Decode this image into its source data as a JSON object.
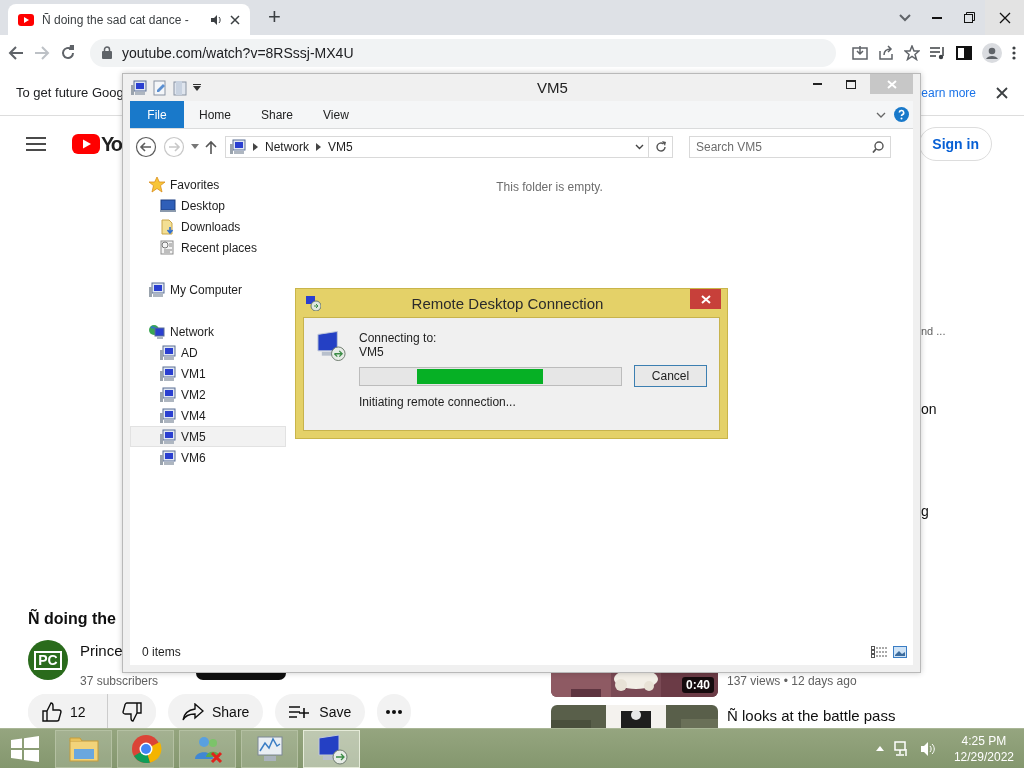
{
  "browser": {
    "tab": {
      "title": "Ñ doing the sad cat dance -"
    },
    "new_tab": "+",
    "url": "youtube.com/watch?v=8RSssj-MX4U",
    "infobar": {
      "text": "To get future Goog",
      "link": "earn more"
    }
  },
  "youtube": {
    "logo_text": "Yo",
    "sign_in": "Sign in",
    "side_texts": [
      "nd ...",
      "on",
      "g"
    ],
    "video_title": "Ñ doing the",
    "channel": {
      "avatar": "PC",
      "name": "Prince",
      "subscribers": "37 subscribers"
    },
    "likes": "12",
    "share": "Share",
    "save": "Save",
    "recommendations": [
      {
        "kind": "picture",
        "duration": "0:40",
        "meta": "137 views • 12 days ago"
      },
      {
        "kind": "picture",
        "title": "Ñ looks at the battle pass"
      }
    ]
  },
  "explorer": {
    "title": "VM5",
    "file_tab": "File",
    "tabs": [
      "Home",
      "Share",
      "View"
    ],
    "breadcrumb": [
      "Network",
      "VM5"
    ],
    "search_placeholder": "Search VM5",
    "nav": [
      {
        "label": "Favorites",
        "kind": "star",
        "selected": false,
        "children": [
          {
            "label": "Desktop",
            "kind": "desktop",
            "selected": false
          },
          {
            "label": "Downloads",
            "kind": "downloads",
            "selected": false
          },
          {
            "label": "Recent places",
            "kind": "recent",
            "selected": false
          }
        ]
      },
      {
        "label": "My Computer",
        "kind": "computer",
        "selected": false
      },
      {
        "label": "Network",
        "kind": "network",
        "selected": false,
        "children": [
          {
            "label": "AD",
            "kind": "computer",
            "selected": false
          },
          {
            "label": "VM1",
            "kind": "computer",
            "selected": false
          },
          {
            "label": "VM2",
            "kind": "computer",
            "selected": false
          },
          {
            "label": "VM4",
            "kind": "computer",
            "selected": false
          },
          {
            "label": "VM5",
            "kind": "computer",
            "selected": true
          },
          {
            "label": "VM6",
            "kind": "computer",
            "selected": false
          }
        ]
      }
    ],
    "empty_text": "This folder is empty.",
    "status": "0 items"
  },
  "dialog": {
    "title": "Remote Desktop Connection",
    "label": "Connecting to:",
    "target": "VM5",
    "level": 0.48,
    "status": "Initiating remote connection...",
    "button": "Cancel"
  },
  "taskbar": {
    "apps": [
      {
        "kind": "explorer",
        "selected": false
      },
      {
        "kind": "chrome",
        "selected": false
      },
      {
        "kind": "messenger",
        "selected": false
      },
      {
        "kind": "monitor",
        "selected": false
      },
      {
        "kind": "remote",
        "selected": true
      }
    ],
    "time": "4:25 PM",
    "date": "12/29/2022"
  }
}
